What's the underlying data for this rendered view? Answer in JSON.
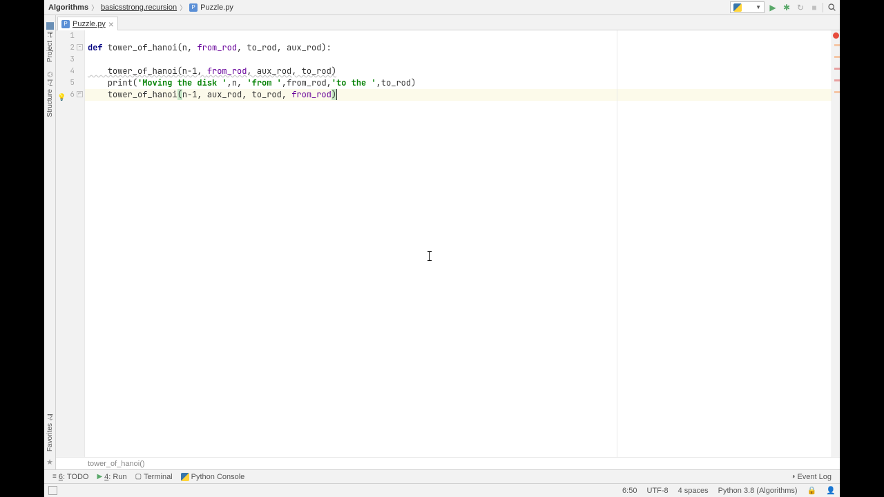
{
  "breadcrumb": {
    "project": "Algorithms",
    "package": "basicsstrong.recursion",
    "file": "Puzzle.py"
  },
  "tab": {
    "name": "Puzzle.py"
  },
  "sidebar": {
    "project_num": "1",
    "project_label": "Project",
    "structure_num": "7",
    "structure_label": "Structure",
    "favorites_num": "2",
    "favorites_label": "Favorites"
  },
  "code": {
    "lines": [
      "1",
      "2",
      "3",
      "4",
      "5",
      "6"
    ],
    "l2_def": "def",
    "l2_sig_a": " tower_of_hanoi(n, ",
    "l2_sig_b": "from_rod",
    "l2_sig_c": ", to_rod, aux_rod):",
    "l4_a": "    tower_of_hanoi(n-1, ",
    "l4_b": "from_rod",
    "l4_c": ", aux_rod, to_rod)",
    "l5_a": "    print(",
    "l5_s1": "'Moving the disk '",
    "l5_b": ",n, ",
    "l5_s2": "'from '",
    "l5_c": ",from_rod,",
    "l5_s3": "'to the '",
    "l5_d": ",to_rod)",
    "l6_a": "    tower_of_hanoi",
    "l6_open": "(",
    "l6_b": "n-1, aux_rod, to_rod, ",
    "l6_c": "from_rod",
    "l6_close": ")"
  },
  "crumb": "tower_of_hanoi()",
  "tools": {
    "todo_num": "6",
    "todo": "TODO",
    "run_num": "4",
    "run": "Run",
    "terminal": "Terminal",
    "console": "Python Console",
    "event_log": "Event Log"
  },
  "status": {
    "pos": "6:50",
    "encoding": "UTF-8",
    "indent": "4 spaces",
    "interpreter": "Python 3.8 (Algorithms)"
  }
}
